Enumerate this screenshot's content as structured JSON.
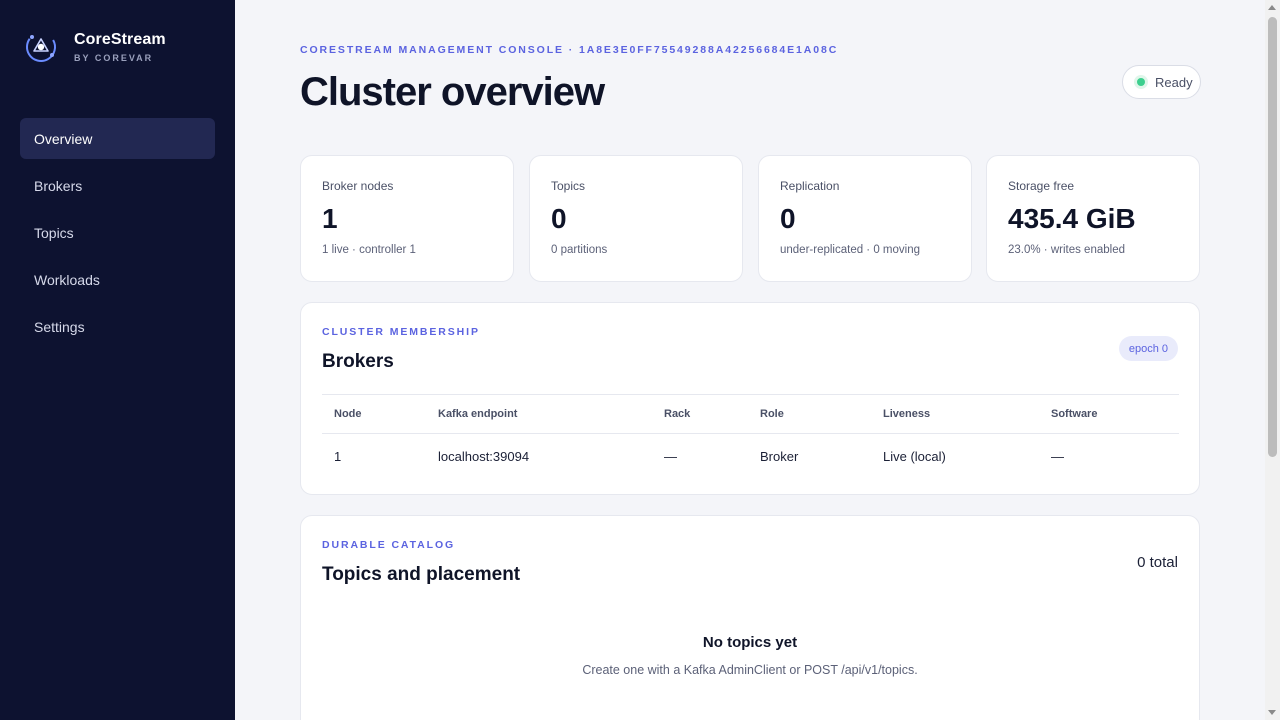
{
  "brand": {
    "name": "CoreStream",
    "sub": "BY COREVAR"
  },
  "nav": [
    {
      "label": "Overview",
      "active": true
    },
    {
      "label": "Brokers"
    },
    {
      "label": "Topics"
    },
    {
      "label": "Workloads"
    },
    {
      "label": "Settings"
    }
  ],
  "header": {
    "eyebrow": "CORESTREAM MANAGEMENT CONSOLE · 1A8E3E0FF75549288A42256684E1A08C",
    "title": "Cluster overview",
    "status": "Ready"
  },
  "stats": [
    {
      "label": "Broker nodes",
      "value": "1",
      "sub": "1 live · controller 1"
    },
    {
      "label": "Topics",
      "value": "0",
      "sub": "0 partitions"
    },
    {
      "label": "Replication",
      "value": "0",
      "sub": "under-replicated · 0 moving"
    },
    {
      "label": "Storage free",
      "value": "435.4 GiB",
      "sub": "23.0% · writes enabled"
    }
  ],
  "brokers_panel": {
    "eyebrow": "CLUSTER MEMBERSHIP",
    "title": "Brokers",
    "badge": "epoch 0",
    "columns": [
      "Node",
      "Kafka endpoint",
      "Rack",
      "Role",
      "Liveness",
      "Software"
    ],
    "rows": [
      [
        "1",
        "localhost:39094",
        "—",
        "Broker",
        "Live (local)",
        "—"
      ]
    ]
  },
  "topics_panel": {
    "eyebrow": "DURABLE CATALOG",
    "title": "Topics and placement",
    "total": "0 total",
    "empty_title": "No topics yet",
    "empty_sub": "Create one with a Kafka AdminClient or POST /api/v1/topics."
  },
  "colors": {
    "sidebar_bg": "#0d1230",
    "accent": "#5b63e0",
    "status_ok": "#3ccf8e",
    "page_bg": "#f4f5f9"
  },
  "icons": {
    "brand": "orbit-logo-icon",
    "status": "status-dot-icon"
  }
}
